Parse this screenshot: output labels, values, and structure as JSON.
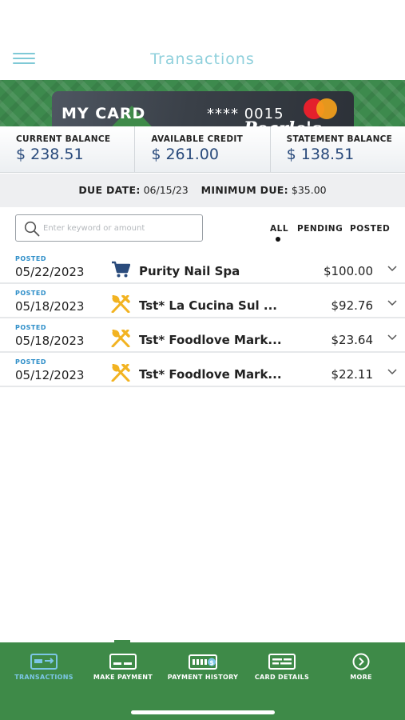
{
  "header": {
    "title": "Transactions",
    "menu_icon": "hamburger-menu-icon"
  },
  "card": {
    "name": "MY CARD",
    "number": "**** 0015",
    "brand_text": "Pearle's",
    "network_icon": "mastercard-logo"
  },
  "balances": [
    {
      "label": "CURRENT BALANCE",
      "value": "$ 238.51"
    },
    {
      "label": "AVAILABLE CREDIT",
      "value": "$ 261.00"
    },
    {
      "label": "STATEMENT BALANCE",
      "value": "$ 138.51"
    }
  ],
  "due": {
    "due_date_label": "DUE DATE:",
    "due_date": "06/15/23",
    "min_due_label": "MINIMUM DUE:",
    "min_due": "$35.00"
  },
  "search": {
    "placeholder": "Enter keyword or amount",
    "icon": "search-icon"
  },
  "filters": {
    "all": "ALL",
    "pending": "PENDING",
    "posted": "POSTED",
    "selected": "ALL"
  },
  "transactions": [
    {
      "status": "POSTED",
      "date": "05/22/2023",
      "merchant": "Purity Nail Spa",
      "amount": "$100.00",
      "icon": "shopping-cart-icon"
    },
    {
      "status": "POSTED",
      "date": "05/18/2023",
      "merchant": "Tst* La Cucina Sul ...",
      "amount": "$92.76",
      "icon": "dining-utensils-icon"
    },
    {
      "status": "POSTED",
      "date": "05/18/2023",
      "merchant": "Tst* Foodlove Mark...",
      "amount": "$23.64",
      "icon": "dining-utensils-icon"
    },
    {
      "status": "POSTED",
      "date": "05/12/2023",
      "merchant": "Tst* Foodlove Mark...",
      "amount": "$22.11",
      "icon": "dining-utensils-icon"
    }
  ],
  "tabbar": {
    "tabs": [
      {
        "label": "TRANSACTIONS",
        "icon": "transactions-card-icon",
        "active": true
      },
      {
        "label": "MAKE PAYMENT",
        "icon": "make-payment-card-icon",
        "active": false
      },
      {
        "label": "PAYMENT HISTORY",
        "icon": "payment-history-icon",
        "active": false
      },
      {
        "label": "CARD DETAILS",
        "icon": "card-details-icon",
        "active": false
      },
      {
        "label": "MORE",
        "icon": "more-chevron-circle-icon",
        "active": false
      }
    ]
  },
  "colors": {
    "brand_green": "#3e8a48",
    "title_teal": "#8fd0dc",
    "balance_blue": "#2a4b7c",
    "status_blue": "#2f8fc9",
    "active_tab": "#7cc6e6",
    "icon_cart": "#2a4b7c",
    "icon_utensils": "#f2b321"
  }
}
